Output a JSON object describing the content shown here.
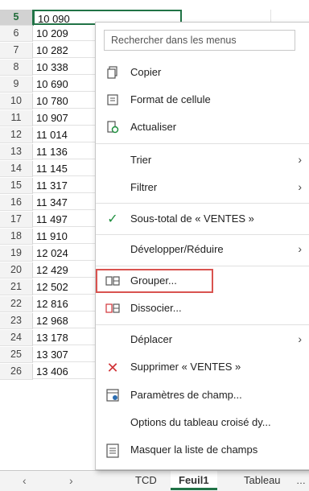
{
  "rows": [
    {
      "num": "5",
      "value": "10 090"
    },
    {
      "num": "6",
      "value": "10 209"
    },
    {
      "num": "7",
      "value": "10 282"
    },
    {
      "num": "8",
      "value": "10 338"
    },
    {
      "num": "9",
      "value": "10 690"
    },
    {
      "num": "10",
      "value": "10 780"
    },
    {
      "num": "11",
      "value": "10 907"
    },
    {
      "num": "12",
      "value": "11 014"
    },
    {
      "num": "13",
      "value": "11 136"
    },
    {
      "num": "14",
      "value": "11 145"
    },
    {
      "num": "15",
      "value": "11 317"
    },
    {
      "num": "16",
      "value": "11 347"
    },
    {
      "num": "17",
      "value": "11 497"
    },
    {
      "num": "18",
      "value": "11 910"
    },
    {
      "num": "19",
      "value": "12 024"
    },
    {
      "num": "20",
      "value": "12 429"
    },
    {
      "num": "21",
      "value": "12 502"
    },
    {
      "num": "22",
      "value": "12 816"
    },
    {
      "num": "23",
      "value": "12 968"
    },
    {
      "num": "24",
      "value": "13 178"
    },
    {
      "num": "25",
      "value": "13 307"
    },
    {
      "num": "26",
      "value": "13 406"
    }
  ],
  "menu": {
    "search_placeholder": "Rechercher dans les menus",
    "items": {
      "copy": "Copier",
      "format": "Format de cellule",
      "refresh": "Actualiser",
      "sort": "Trier",
      "filter": "Filtrer",
      "subtotal": "Sous-total de « VENTES »",
      "expand": "Développer/Réduire",
      "group": "Grouper...",
      "ungroup": "Dissocier...",
      "move": "Déplacer",
      "remove": "Supprimer « VENTES »",
      "field_settings": "Paramètres de champ...",
      "pivot_options": "Options du tableau croisé dy...",
      "hide_field_list": "Masquer la liste de champs"
    }
  },
  "tabs": [
    "TCD",
    "Feuil1",
    "Tableau"
  ],
  "colors": {
    "excel_green": "#217346",
    "highlight_red": "#d9534f",
    "check_green": "#1e8e3e",
    "delete_red": "#d13438"
  }
}
